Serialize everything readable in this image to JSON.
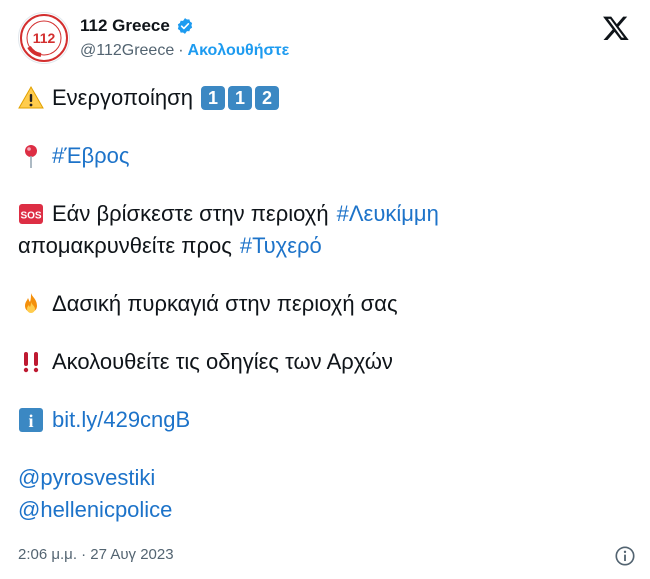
{
  "account": {
    "display_name": "112 Greece",
    "handle": "@112Greece",
    "separator": "·",
    "follow_label": "Ακολουθήστε",
    "avatar_text": "112"
  },
  "tweet": {
    "line1_text": "Ενεργοποίηση",
    "line1_keys": [
      "1",
      "1",
      "2"
    ],
    "line2_hashtag": "#Έβρος",
    "line3_text": "Εάν βρίσκεστε στην περιοχή",
    "line3_hashtag": "#Λευκίμμη",
    "line4_text": "απομακρυνθείτε προς",
    "line4_hashtag": "#Τυχερό",
    "line5_text": "Δασική πυρκαγιά στην περιοχή σας",
    "line6_text": "Ακολουθείτε τις οδηγίες των Αρχών",
    "line7_link": "bit.ly/429cngB",
    "mention1": "@pyrosvestiki",
    "mention2": "@hellenicpolice",
    "sos_label": "SOS",
    "info_label": "i"
  },
  "footer": {
    "timestamp": "2:06 μ.μ. · 27 Αυγ 2023"
  },
  "icons": {
    "warning": "warning-icon",
    "pin": "round-pushpin-icon",
    "sos": "sos-icon",
    "fire": "fire-icon",
    "bangbang": "double-exclamation-icon",
    "info": "information-icon",
    "verified": "verified-badge-icon",
    "x": "x-logo-icon",
    "info_outline": "info-circle-icon"
  },
  "colors": {
    "link": "#1d73c9",
    "follow": "#1d9bf0",
    "muted": "#536471",
    "verified": "#1d9bf0",
    "key_blue": "#3b88c3",
    "sos_red": "#dd2e44"
  }
}
